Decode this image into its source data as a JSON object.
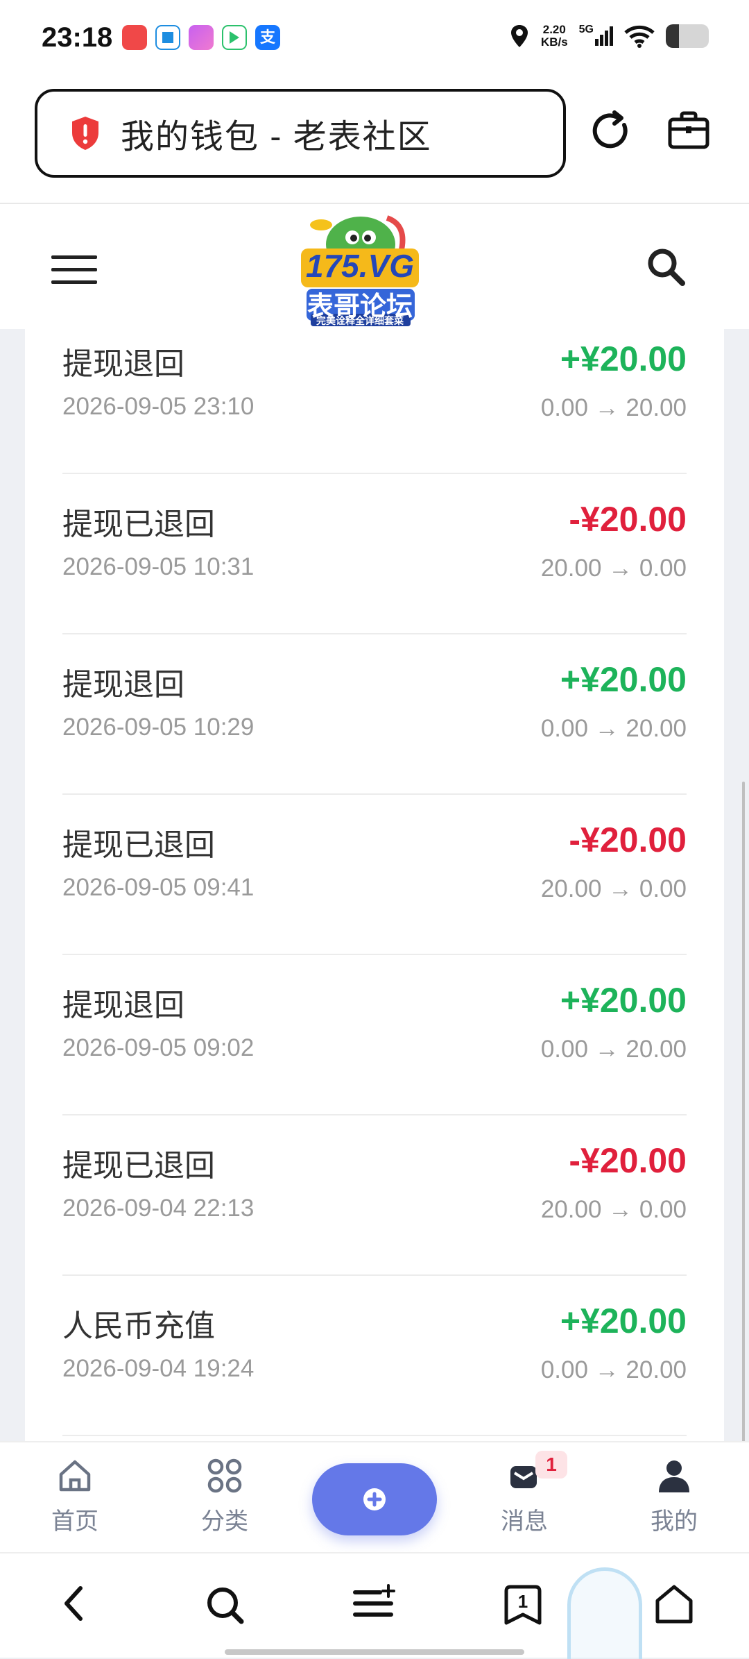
{
  "status_bar": {
    "time": "23:18",
    "network_speed_value": "2.20",
    "network_speed_unit": "KB/s",
    "signal": "5G",
    "battery_level": 0.3,
    "notification_apps": [
      "clown-app",
      "blue-app",
      "purple-app",
      "video-app",
      "alipay-app"
    ],
    "alipay_glyph": "支"
  },
  "browser": {
    "url_title": "我的钱包 - 老表社区",
    "shield_icon": "shield-alert-icon",
    "reload_icon": "reload-icon",
    "toolbox_icon": "briefcase-icon"
  },
  "site_header": {
    "logo_text": "175.VG",
    "logo_subtitle": "表哥论坛",
    "logo_tagline": "完美诠释全详细套菜",
    "menu_icon": "hamburger-menu-icon",
    "search_icon": "search-icon"
  },
  "transactions": [
    {
      "title": "提现退回",
      "date": "2026-09-05 23:10",
      "amount": "+¥20.00",
      "balance": "0.00 → 20.00",
      "direction": "in"
    },
    {
      "title": "提现已退回",
      "date": "2026-09-05 10:31",
      "amount": "-¥20.00",
      "balance": "20.00 → 0.00",
      "direction": "out"
    },
    {
      "title": "提现退回",
      "date": "2026-09-05 10:29",
      "amount": "+¥20.00",
      "balance": "0.00 → 20.00",
      "direction": "in"
    },
    {
      "title": "提现已退回",
      "date": "2026-09-05 09:41",
      "amount": "-¥20.00",
      "balance": "20.00 → 0.00",
      "direction": "out"
    },
    {
      "title": "提现退回",
      "date": "2026-09-05 09:02",
      "amount": "+¥20.00",
      "balance": "0.00 → 20.00",
      "direction": "in"
    },
    {
      "title": "提现已退回",
      "date": "2026-09-04 22:13",
      "amount": "-¥20.00",
      "balance": "20.00 → 0.00",
      "direction": "out"
    },
    {
      "title": "人民币充值",
      "date": "2026-09-04 19:24",
      "amount": "+¥20.00",
      "balance": "0.00 → 20.00",
      "direction": "in"
    }
  ],
  "tab_bar": {
    "home": "首页",
    "category": "分类",
    "messages": "消息",
    "messages_badge": "1",
    "mine": "我的",
    "fab_icon": "plus-circle-icon"
  },
  "browser_nav": {
    "tabs_count": "1"
  },
  "colors": {
    "positive": "#1db35a",
    "negative": "#e0203c",
    "accent": "#6478e8"
  }
}
